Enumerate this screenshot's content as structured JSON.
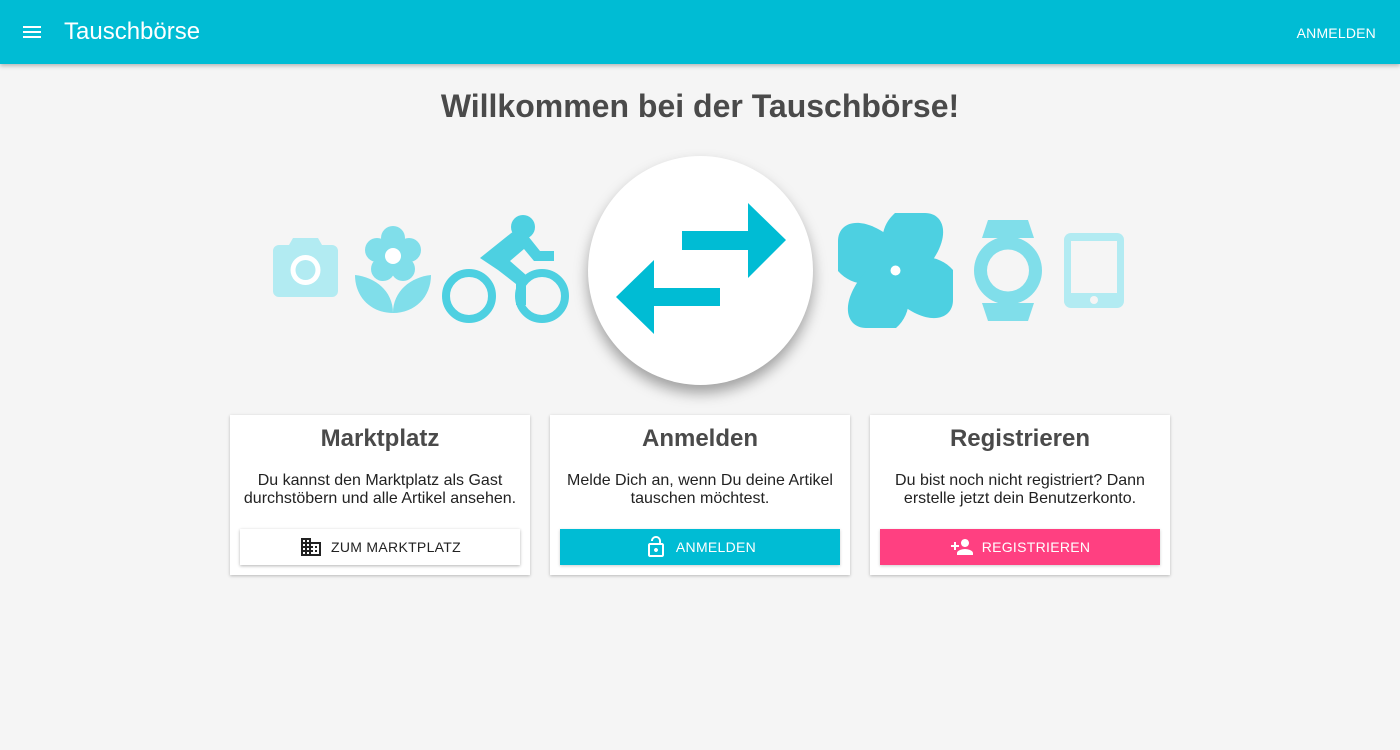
{
  "app": {
    "title": "Tauschbörse",
    "login_label": "ANMELDEN",
    "menu_icon": "menu-icon"
  },
  "main": {
    "headline": "Willkommen bei der Tauschbörse!"
  },
  "hero": {
    "icons": [
      "camera-icon",
      "flower-icon",
      "bicycle-icon",
      "swap-arrows-icon",
      "pinwheel-icon",
      "watch-icon",
      "tablet-icon"
    ],
    "accent_color": "#00bcd4"
  },
  "cards": [
    {
      "title": "Marktplatz",
      "text": "Du kannst den Marktplatz als Gast durchstöbern und alle Artikel ansehen.",
      "button_label": "ZUM MARKTPLATZ",
      "button_icon": "building-icon",
      "button_color": "#ffffff"
    },
    {
      "title": "Anmelden",
      "text": "Melde Dich an, wenn Du deine Artikel tauschen möchtest.",
      "button_label": "ANMELDEN",
      "button_icon": "lock-open-icon",
      "button_color": "#00bcd4"
    },
    {
      "title": "Registrieren",
      "text": "Du bist noch nicht registriert? Dann erstelle jetzt dein Benutzerkonto.",
      "button_label": "REGISTRIEREN",
      "button_icon": "person-add-icon",
      "button_color": "#ff4081"
    }
  ]
}
